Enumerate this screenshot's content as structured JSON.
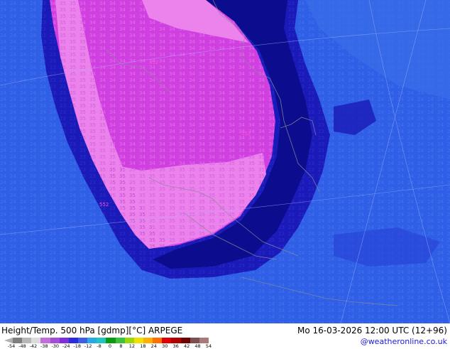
{
  "header": {
    "title": "Height/Temp. 500 hPa [gdmp][°C] ARPEGE",
    "datetime": "Mo 16-03-2026 12:00 UTC (12+96)",
    "credit": "@weatheronline.co.uk"
  },
  "legend": {
    "labels": [
      "-54",
      "-48",
      "-42",
      "-38",
      "-30",
      "-24",
      "-18",
      "-12",
      "-8",
      "0",
      "8",
      "12",
      "18",
      "24",
      "30",
      "36",
      "42",
      "48",
      "54"
    ],
    "colors": [
      "#7f7f7f",
      "#b7b7b7",
      "#dcdcdc",
      "#c070d8",
      "#a64ad8",
      "#7d2fd8",
      "#2b2be0",
      "#3d5fe0",
      "#27a8e8",
      "#21c3c3",
      "#0a9a10",
      "#3cc23c",
      "#9ad80a",
      "#f0e000",
      "#ffb000",
      "#ff7000",
      "#e00000",
      "#b00000",
      "#700000",
      "#7a5050",
      "#aa7a7a"
    ]
  },
  "map": {
    "colors": {
      "background": "#2e5fe6",
      "dark_band": "#1a1ab8",
      "very_dark": "#0c0c8e",
      "magenta": "#d040e0",
      "pink": "#ec82ec",
      "contour_text": "#ff4fd8"
    }
  }
}
